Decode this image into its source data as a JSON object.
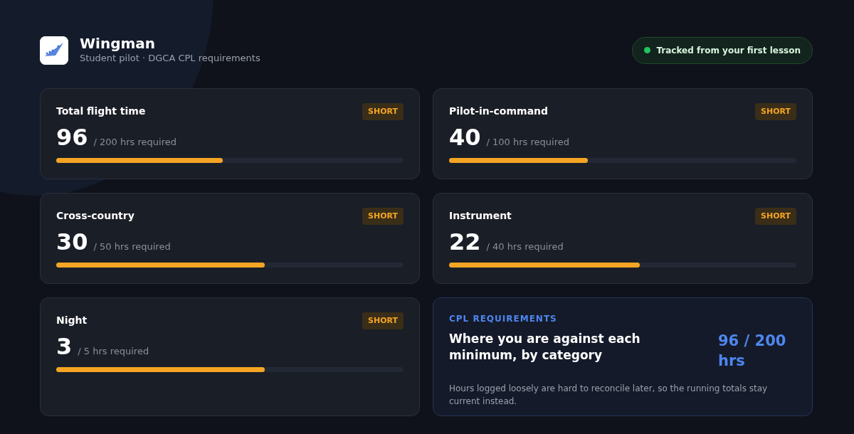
{
  "app": {
    "name": "Wingman",
    "subtitle": "Student pilot · DGCA CPL requirements"
  },
  "status_pill": {
    "label": "Tracked from your first lesson",
    "color": "#22c55e"
  },
  "metrics": [
    {
      "title": "Total flight time",
      "badge": "SHORT",
      "value": "96",
      "required": "/ 200 hrs required",
      "level": 0.48
    },
    {
      "title": "Pilot-in-command",
      "badge": "SHORT",
      "value": "40",
      "required": "/ 100 hrs required",
      "level": 0.4
    },
    {
      "title": "Cross-country",
      "badge": "SHORT",
      "value": "30",
      "required": "/ 50 hrs required",
      "level": 0.6
    },
    {
      "title": "Instrument",
      "badge": "SHORT",
      "value": "22",
      "required": "/ 40 hrs required",
      "level": 0.55
    },
    {
      "title": "Night",
      "badge": "SHORT",
      "value": "3",
      "required": "/ 5 hrs required",
      "level": 0.6
    }
  ],
  "summary": {
    "eyebrow": "CPL REQUIREMENTS",
    "heading": "Where you are against each minimum, by category",
    "total": "96 / 200 hrs",
    "note": "Hours logged loosely are hard to reconcile later, so the running totals stay current instead."
  }
}
